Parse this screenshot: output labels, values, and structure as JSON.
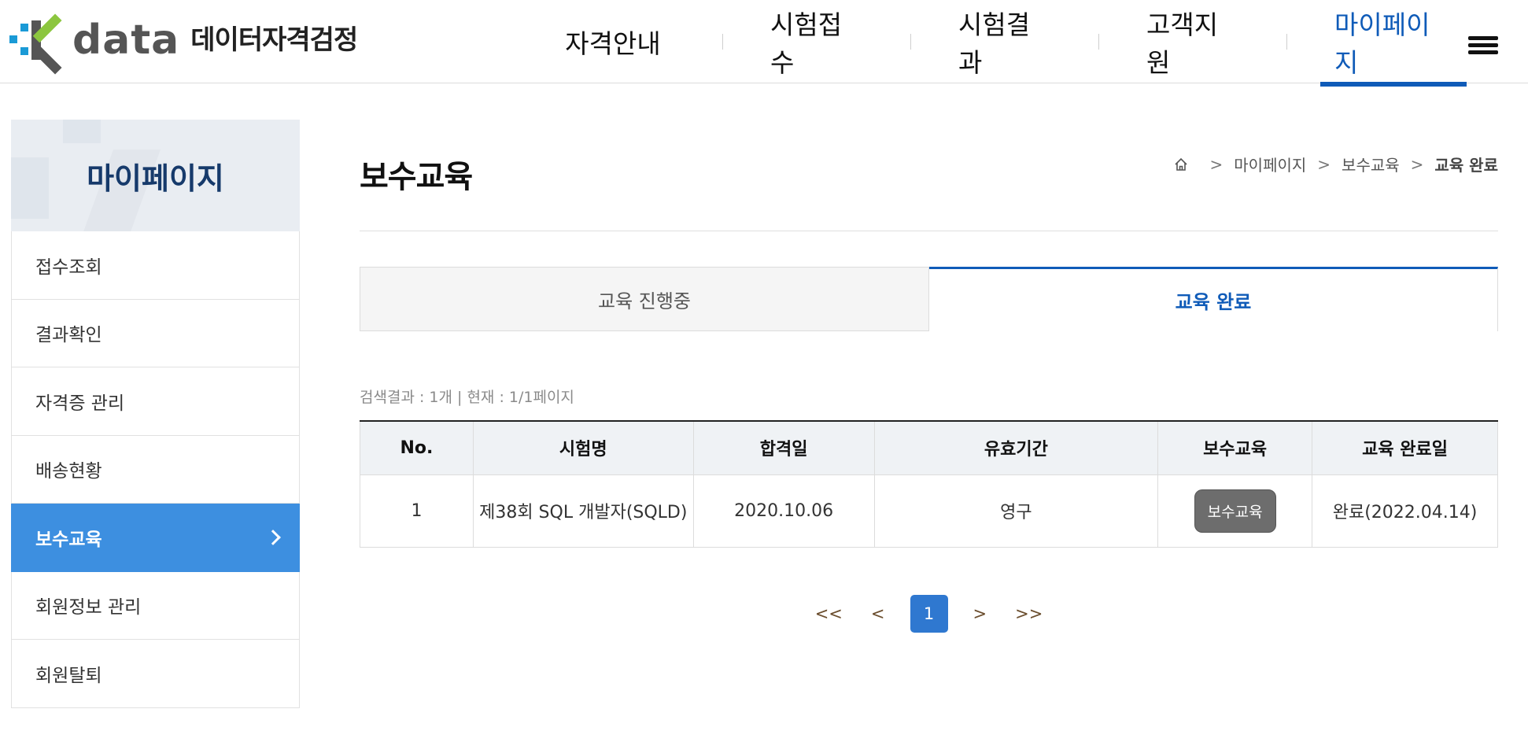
{
  "header": {
    "logo_word": "data",
    "logo_sub": "데이터자격검정",
    "nav": [
      {
        "label": "자격안내"
      },
      {
        "label": "시험접수"
      },
      {
        "label": "시험결과"
      },
      {
        "label": "고객지원"
      },
      {
        "label": "마이페이지",
        "active": true
      }
    ]
  },
  "sidebar": {
    "title": "마이페이지",
    "items": [
      {
        "label": "접수조회"
      },
      {
        "label": "결과확인"
      },
      {
        "label": "자격증 관리"
      },
      {
        "label": "배송현황"
      },
      {
        "label": "보수교육",
        "active": true
      },
      {
        "label": "회원정보 관리"
      },
      {
        "label": "회원탈퇴"
      }
    ]
  },
  "main": {
    "title": "보수교육",
    "breadcrumb": [
      "마이페이지",
      "보수교육",
      "교육 완료"
    ],
    "tabs": [
      {
        "label": "교육 진행중"
      },
      {
        "label": "교육 완료",
        "active": true
      }
    ],
    "result_info": "검색결과 : 1개 | 현재 : 1/1페이지",
    "table": {
      "headers": [
        "No.",
        "시험명",
        "합격일",
        "유효기간",
        "보수교육",
        "교육 완료일"
      ],
      "rows": [
        {
          "no": "1",
          "exam": "제38회 SQL 개발자(SQLD)",
          "pass_date": "2020.10.06",
          "validity": "영구",
          "edu_button": "보수교육",
          "completed": "완료(2022.04.14)"
        }
      ]
    },
    "pagination": {
      "first": "<<",
      "prev": "<",
      "current": "1",
      "next": ">",
      "last": ">>"
    }
  },
  "colors": {
    "brand_blue": "#0f5bb8",
    "sidebar_active": "#3d8fe0",
    "logo_green": "#8cc63f",
    "logo_cyan": "#1a9ad6"
  }
}
